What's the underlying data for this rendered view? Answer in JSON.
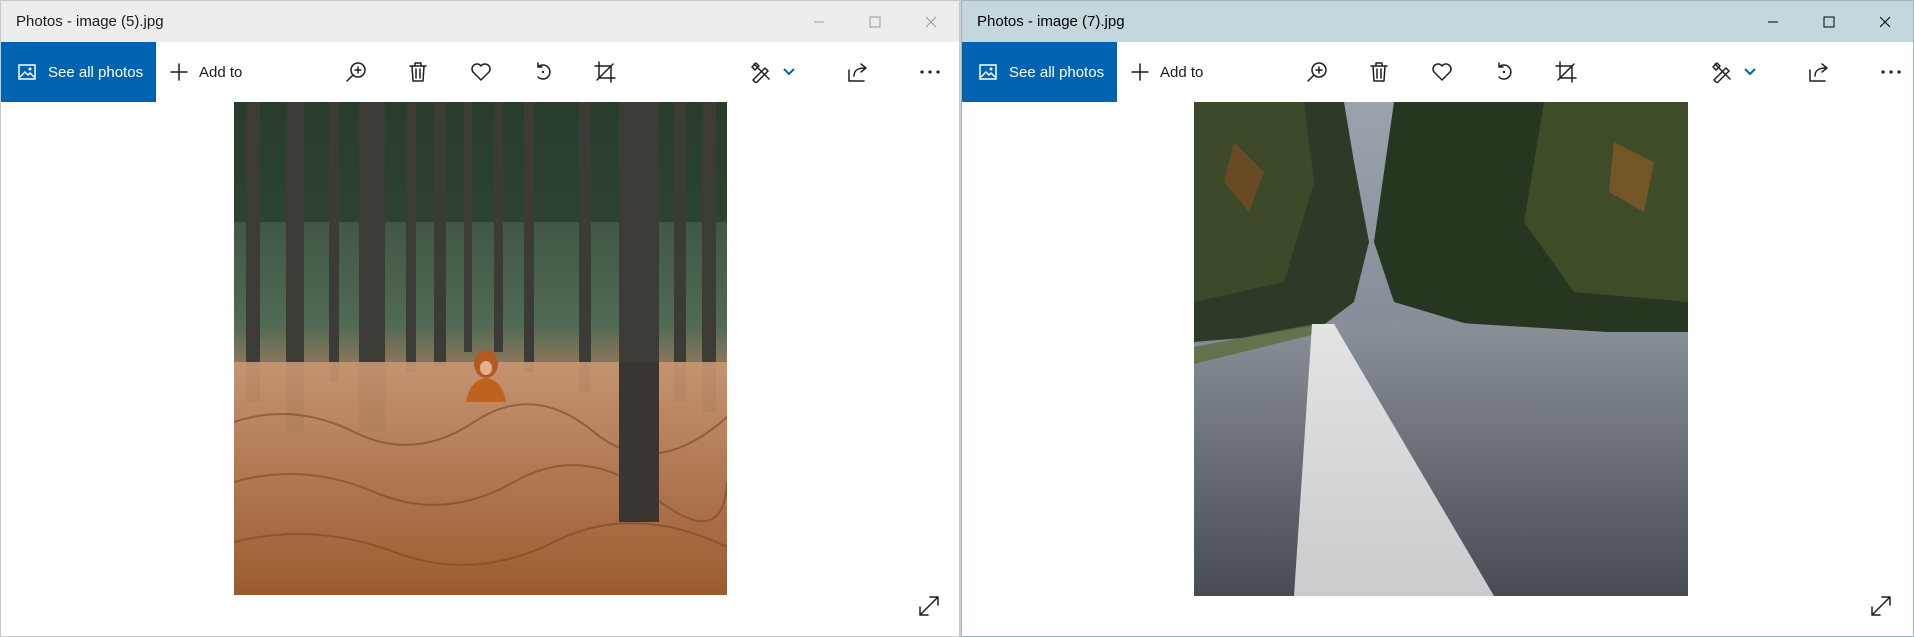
{
  "windows": [
    {
      "title": "Photos - image (5).jpg",
      "state": "inactive",
      "toolbar": {
        "see_all_label": "See all photos",
        "add_to_label": "Add to"
      },
      "photo": {
        "subject": "person in orange hoodie among pine trees and dry ferns"
      }
    },
    {
      "title": "Photos - image (7).jpg",
      "state": "active",
      "toolbar": {
        "see_all_label": "See all photos",
        "add_to_label": "Add to"
      },
      "photo": {
        "subject": "asphalt road with white line through forest"
      }
    }
  ],
  "toolbar_icons": [
    "zoom-icon",
    "delete-icon",
    "favorite-icon",
    "rotate-icon",
    "crop-icon",
    "edit-icon",
    "chevron-down-icon",
    "share-icon",
    "more-icon"
  ],
  "colors": {
    "accent": "#0063b1",
    "active_titlebar": "#c4d7dc",
    "inactive_titlebar": "#ededed"
  }
}
